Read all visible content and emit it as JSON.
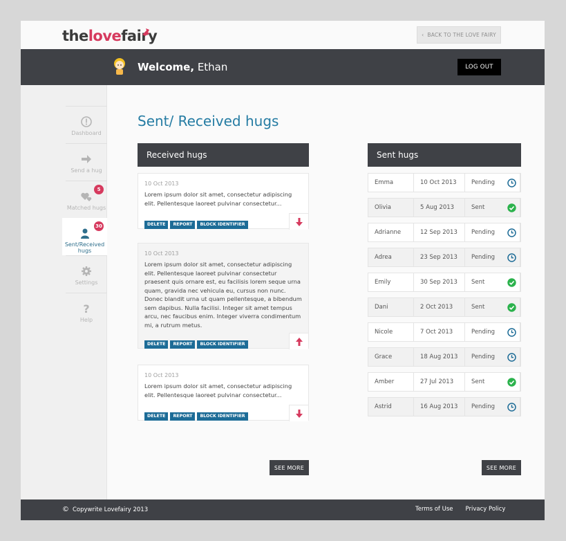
{
  "header": {
    "logo_the": "the",
    "logo_love": "love",
    "logo_fairy": "fairy",
    "back_label": "BACK TO THE LOVE FAIRY"
  },
  "welcome": {
    "greeting": "Welcome,",
    "name": "Ethan",
    "logout_label": "LOG OUT"
  },
  "sidebar": {
    "items": [
      {
        "label": "Dashboard",
        "icon": "dashboard-icon",
        "badge": ""
      },
      {
        "label": "Send a hug",
        "icon": "arrow-right-icon",
        "badge": ""
      },
      {
        "label": "Matched hugs",
        "icon": "hearts-icon",
        "badge": "5"
      },
      {
        "label": "Sent/Received hugs",
        "icon": "user-icon",
        "badge": "30"
      },
      {
        "label": "Settings",
        "icon": "gear-icon",
        "badge": ""
      },
      {
        "label": "Help",
        "icon": "question-icon",
        "badge": ""
      }
    ]
  },
  "page": {
    "title": "Sent/ Received hugs"
  },
  "received": {
    "heading": "Received hugs",
    "actions": [
      "DELETE",
      "REPORT",
      "BLOCK IDENTIFIER"
    ],
    "cards": [
      {
        "date": "10 Oct 2013",
        "text": "Lorem ipsum dolor sit amet, consectetur adipiscing elit. Pellentesque laoreet pulvinar consectetur...",
        "arrow": "down-arrow-icon"
      },
      {
        "date": "10 Oct 2013",
        "text": "Lorem ipsum dolor sit amet, consectetur adipiscing elit. Pellentesque laoreet pulvinar consectetur praesent quis ornare est, eu facilisis lorem seque urna quam, gravida nec vehicula eu, cursus non nunc. Donec blandit urna ut quam pellentesque, a bibendum sem dapibus. Nulla facilisi. Integer sit amet tempus arcu, nec faucibus enim. Integer viverra condimentum mi, a rutrum metus.",
        "arrow": "up-arrow-icon"
      },
      {
        "date": "10 Oct 2013",
        "text": "Lorem ipsum dolor sit amet, consectetur adipiscing elit. Pellentesque laoreet pulvinar consectetur...",
        "arrow": "down-arrow-icon"
      }
    ],
    "see_more": "SEE MORE"
  },
  "sent": {
    "heading": "Sent hugs",
    "rows": [
      {
        "name": "Emma",
        "date": "10 Oct 2013",
        "status": "Pending",
        "icon": "clock-icon"
      },
      {
        "name": "Olivia",
        "date": "5 Aug 2013",
        "status": "Sent",
        "icon": "check-icon"
      },
      {
        "name": "Adrianne",
        "date": "12 Sep 2013",
        "status": "Pending",
        "icon": "clock-icon"
      },
      {
        "name": "Adrea",
        "date": "23 Sep 2013",
        "status": "Pending",
        "icon": "clock-icon"
      },
      {
        "name": "Emily",
        "date": "30 Sep 2013",
        "status": "Sent",
        "icon": "check-icon"
      },
      {
        "name": "Dani",
        "date": "2 Oct 2013",
        "status": "Sent",
        "icon": "check-icon"
      },
      {
        "name": "Nicole",
        "date": "7 Oct 2013",
        "status": "Pending",
        "icon": "clock-icon"
      },
      {
        "name": "Grace",
        "date": "18 Aug 2013",
        "status": "Pending",
        "icon": "clock-icon"
      },
      {
        "name": "Amber",
        "date": "27 Jul 2013",
        "status": "Sent",
        "icon": "check-icon"
      },
      {
        "name": "Astrid",
        "date": "16 Aug 2013",
        "status": "Pending",
        "icon": "clock-icon"
      }
    ],
    "see_more": "SEE MORE"
  },
  "footer": {
    "copyright": "Copywrite Lovefairy 2013",
    "terms": "Terms of Use",
    "privacy": "Privacy Policy"
  },
  "colors": {
    "accent": "#257ca3",
    "dark": "#3f4146",
    "brand_pink": "#d63a5e",
    "button_blue": "#1d6c97",
    "check_green": "#2bb24c"
  }
}
